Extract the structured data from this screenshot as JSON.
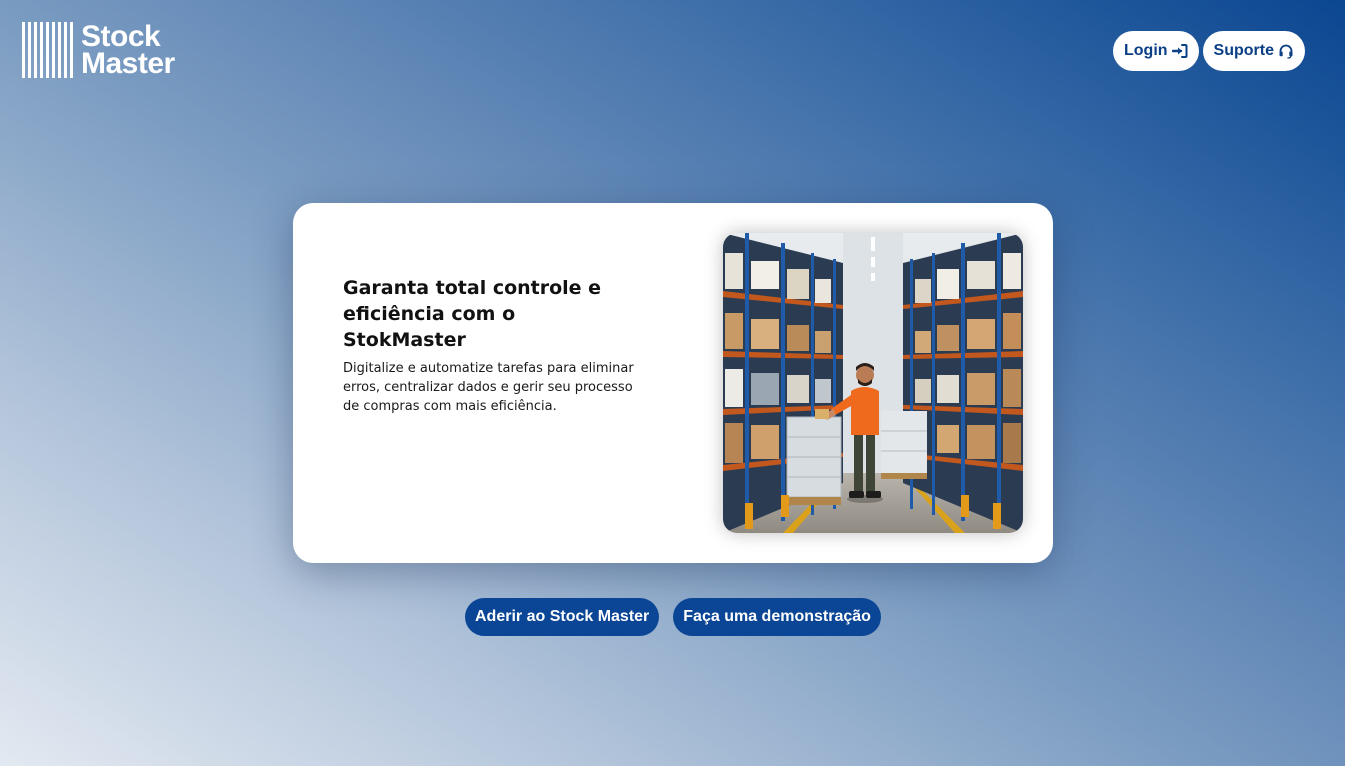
{
  "brand": {
    "line1": "Stock",
    "line2": "Master"
  },
  "nav": {
    "login_label": "Login",
    "support_label": "Suporte"
  },
  "hero": {
    "title": "Garanta total controle e eficiência com o StokMaster",
    "description": "Digitalize e automatize tarefas para eliminar erros, centralizar dados e gerir seu processo de compras com mais eficiência.",
    "image_subject": "warehouse-worker-photo"
  },
  "actions": {
    "join_label": "Aderir ao Stock Master",
    "demo_label": "Faça uma demonstração"
  },
  "colors": {
    "primary": "#0b4696",
    "nav_text": "#0b3f86",
    "card_bg": "#ffffff",
    "gradient_dark": "#0b4691",
    "gradient_light": "#e3e9f1"
  },
  "icons": {
    "login": "sign-in-icon",
    "support": "headset-icon",
    "logo": "barcode-icon"
  }
}
